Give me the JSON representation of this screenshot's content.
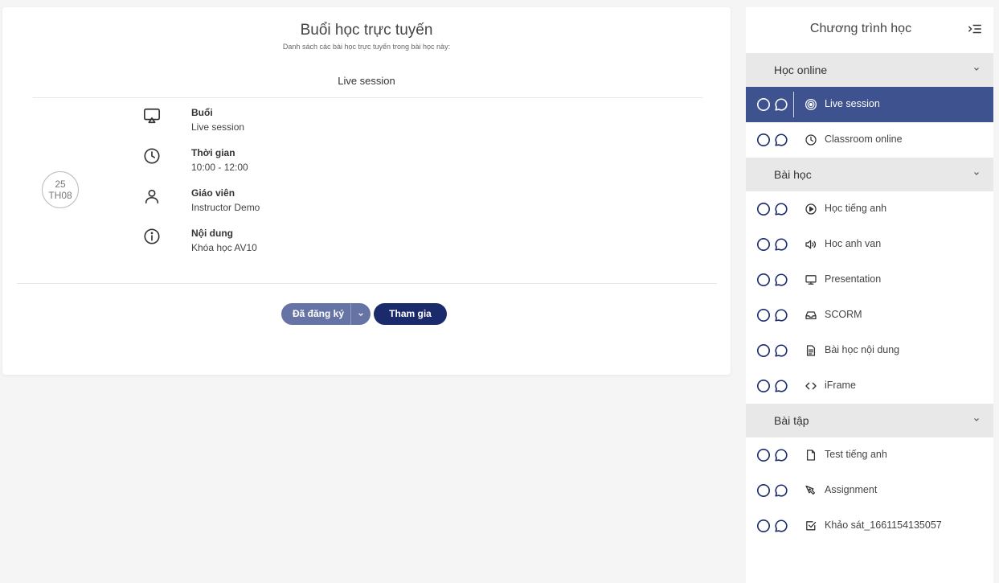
{
  "main": {
    "title": "Buổi học trực tuyến",
    "subtitle": "Danh sách các bài học trực tuyến trong bài học này:",
    "session_heading": "Live session",
    "date": {
      "day": "25",
      "month": "TH08"
    },
    "info": [
      {
        "icon": "airplay-icon",
        "label": "Buổi",
        "value": "Live session"
      },
      {
        "icon": "clock-icon",
        "label": "Thời gian",
        "value": "10:00 - 12:00"
      },
      {
        "icon": "user-icon",
        "label": "Giáo viên",
        "value": "Instructor Demo"
      },
      {
        "icon": "info-icon",
        "label": "Nội dung",
        "value": "Khóa học AV10"
      }
    ],
    "registered_label": "Đã đăng ký",
    "join_label": "Tham gia"
  },
  "sidebar": {
    "title": "Chương trình học",
    "sections": [
      {
        "name": "Học online",
        "items": [
          {
            "label": "Live session",
            "icon": "live-icon",
            "active": true
          },
          {
            "label": "Classroom online",
            "icon": "clock-icon"
          }
        ]
      },
      {
        "name": "Bài học",
        "items": [
          {
            "label": "Học tiếng anh",
            "icon": "play-icon"
          },
          {
            "label": "Hoc anh van",
            "icon": "audio-icon"
          },
          {
            "label": "Presentation",
            "icon": "monitor-icon"
          },
          {
            "label": "SCORM",
            "icon": "inbox-icon"
          },
          {
            "label": "Bài học nội dung",
            "icon": "document-icon"
          },
          {
            "label": "iFrame",
            "icon": "code-icon"
          }
        ]
      },
      {
        "name": "Bài tập",
        "items": [
          {
            "label": "Test tiếng anh",
            "icon": "file-icon"
          },
          {
            "label": "Assignment",
            "icon": "pen-icon"
          },
          {
            "label": "Khảo sát_1661154135057",
            "icon": "checkbox-icon"
          }
        ]
      }
    ]
  },
  "colors": {
    "active_bg": "#3e5290",
    "registered_bg": "#6574a5",
    "join_bg": "#1b2a6b",
    "section_bg": "#e8e8e8"
  }
}
